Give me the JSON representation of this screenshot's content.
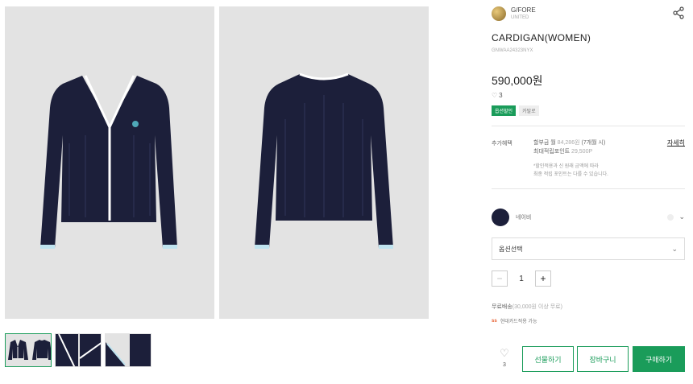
{
  "brand": {
    "name": "G/FORE",
    "sub": "UNITED"
  },
  "product": {
    "title": "CARDIGAN(WOMEN)",
    "code": "GNWAA24323NYX",
    "price": "590,000원",
    "likes": "3",
    "badges": [
      "옵션할인",
      "카탈로"
    ]
  },
  "benefits": {
    "label": "추가혜택",
    "line1_prefix": "할부금 월",
    "line1_amount": "84,286원",
    "line1_suffix": "(7개월 시)",
    "line2_prefix": "최대적립포인트",
    "line2_amount": "29,500P",
    "note1": "*할인적용과 신 원래 금액에 따라",
    "note2": "최종 적립 포인트는 다를 수 있습니다.",
    "detail_link": "자세히"
  },
  "color": {
    "name": "네이비",
    "hex": "#1c1f3a"
  },
  "option": {
    "placeholder": "옵션선택"
  },
  "quantity": {
    "value": "1",
    "minus": "−",
    "plus": "+"
  },
  "shipping": {
    "text": "무료배송",
    "muted": "(30,000원 이상 무료)"
  },
  "payment": {
    "logo": "ss",
    "text": "현대카드적용 가능"
  },
  "actions": {
    "like_count": "3",
    "gift": "선물하기",
    "cart": "장바구니",
    "buy": "구매하기"
  },
  "colors": {
    "accent": "#1a9c5a",
    "navy": "#1c1f3a",
    "image_bg": "#e3e3e3"
  },
  "icons": [
    "share-icon",
    "heart-icon",
    "chevron-down-icon",
    "minus-icon",
    "plus-icon"
  ]
}
